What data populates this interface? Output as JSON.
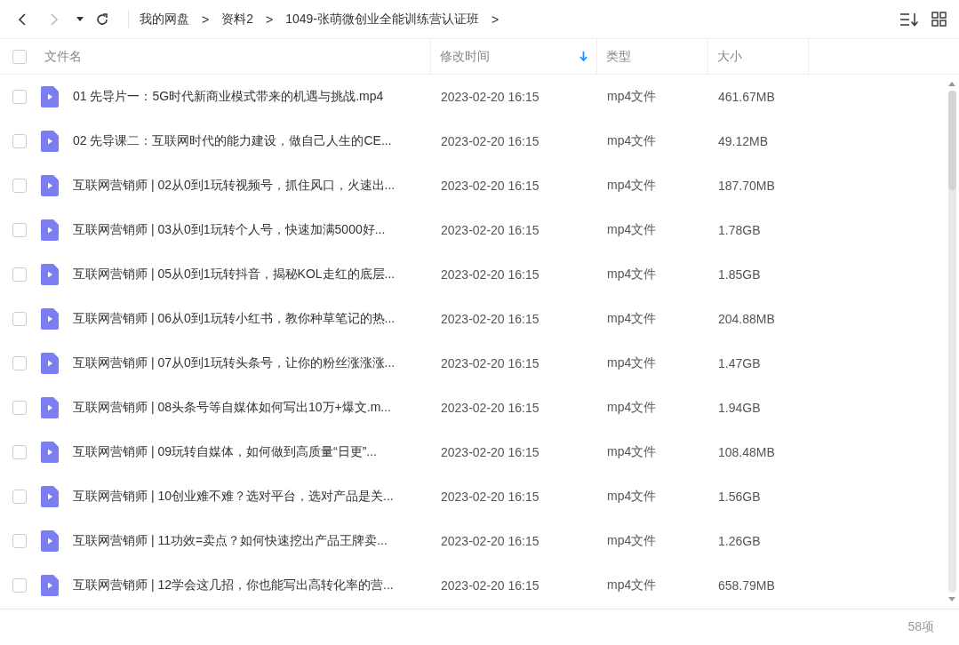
{
  "breadcrumb": [
    "我的网盘",
    "资料2",
    "1049-张萌微创业全能训练营认证班"
  ],
  "breadcrumb_separator": ">",
  "header": {
    "select_all": {
      "checked": false
    },
    "columns": [
      {
        "label": "文件名",
        "sorted": false
      },
      {
        "label": "修改时间",
        "sorted": true
      },
      {
        "label": "类型",
        "sorted": false
      },
      {
        "label": "大小",
        "sorted": false
      }
    ]
  },
  "rows": [
    {
      "checked": false,
      "name": "01 先导片一：5G时代新商业模式带来的机遇与挑战.mp4",
      "modified": "2023-02-20 16:15",
      "type": "mp4文件",
      "size": "461.67MB"
    },
    {
      "checked": false,
      "name": "02 先导课二：互联网时代的能力建设，做自己人生的CE...",
      "modified": "2023-02-20 16:15",
      "type": "mp4文件",
      "size": "49.12MB"
    },
    {
      "checked": false,
      "name": "互联网营销师 | 02从0到1玩转视频号，抓住风口，火速出...",
      "modified": "2023-02-20 16:15",
      "type": "mp4文件",
      "size": "187.70MB"
    },
    {
      "checked": false,
      "name": "互联网营销师 | 03从0到1玩转个人号，快速加满5000好...",
      "modified": "2023-02-20 16:15",
      "type": "mp4文件",
      "size": "1.78GB"
    },
    {
      "checked": false,
      "name": "互联网营销师 | 05从0到1玩转抖音，揭秘KOL走红的底层...",
      "modified": "2023-02-20 16:15",
      "type": "mp4文件",
      "size": "1.85GB"
    },
    {
      "checked": false,
      "name": "互联网营销师 | 06从0到1玩转小红书，教你种草笔记的热...",
      "modified": "2023-02-20 16:15",
      "type": "mp4文件",
      "size": "204.88MB"
    },
    {
      "checked": false,
      "name": "互联网营销师 | 07从0到1玩转头条号，让你的粉丝涨涨涨...",
      "modified": "2023-02-20 16:15",
      "type": "mp4文件",
      "size": "1.47GB"
    },
    {
      "checked": false,
      "name": "互联网营销师 | 08头条号等自媒体如何写出10万+爆文.m...",
      "modified": "2023-02-20 16:15",
      "type": "mp4文件",
      "size": "1.94GB"
    },
    {
      "checked": false,
      "name": "互联网营销师 | 09玩转自媒体，如何做到高质量“日更”...",
      "modified": "2023-02-20 16:15",
      "type": "mp4文件",
      "size": "108.48MB"
    },
    {
      "checked": false,
      "name": "互联网营销师 | 10创业难不难？选对平台，选对产品是关...",
      "modified": "2023-02-20 16:15",
      "type": "mp4文件",
      "size": "1.56GB"
    },
    {
      "checked": false,
      "name": "互联网营销师 | 11功效=卖点？如何快速挖出产品王牌卖...",
      "modified": "2023-02-20 16:15",
      "type": "mp4文件",
      "size": "1.26GB"
    },
    {
      "checked": false,
      "name": "互联网营销师 | 12学会这几招，你也能写出高转化率的营...",
      "modified": "2023-02-20 16:15",
      "type": "mp4文件",
      "size": "658.79MB"
    }
  ],
  "status_bar": {
    "count": "58项"
  }
}
